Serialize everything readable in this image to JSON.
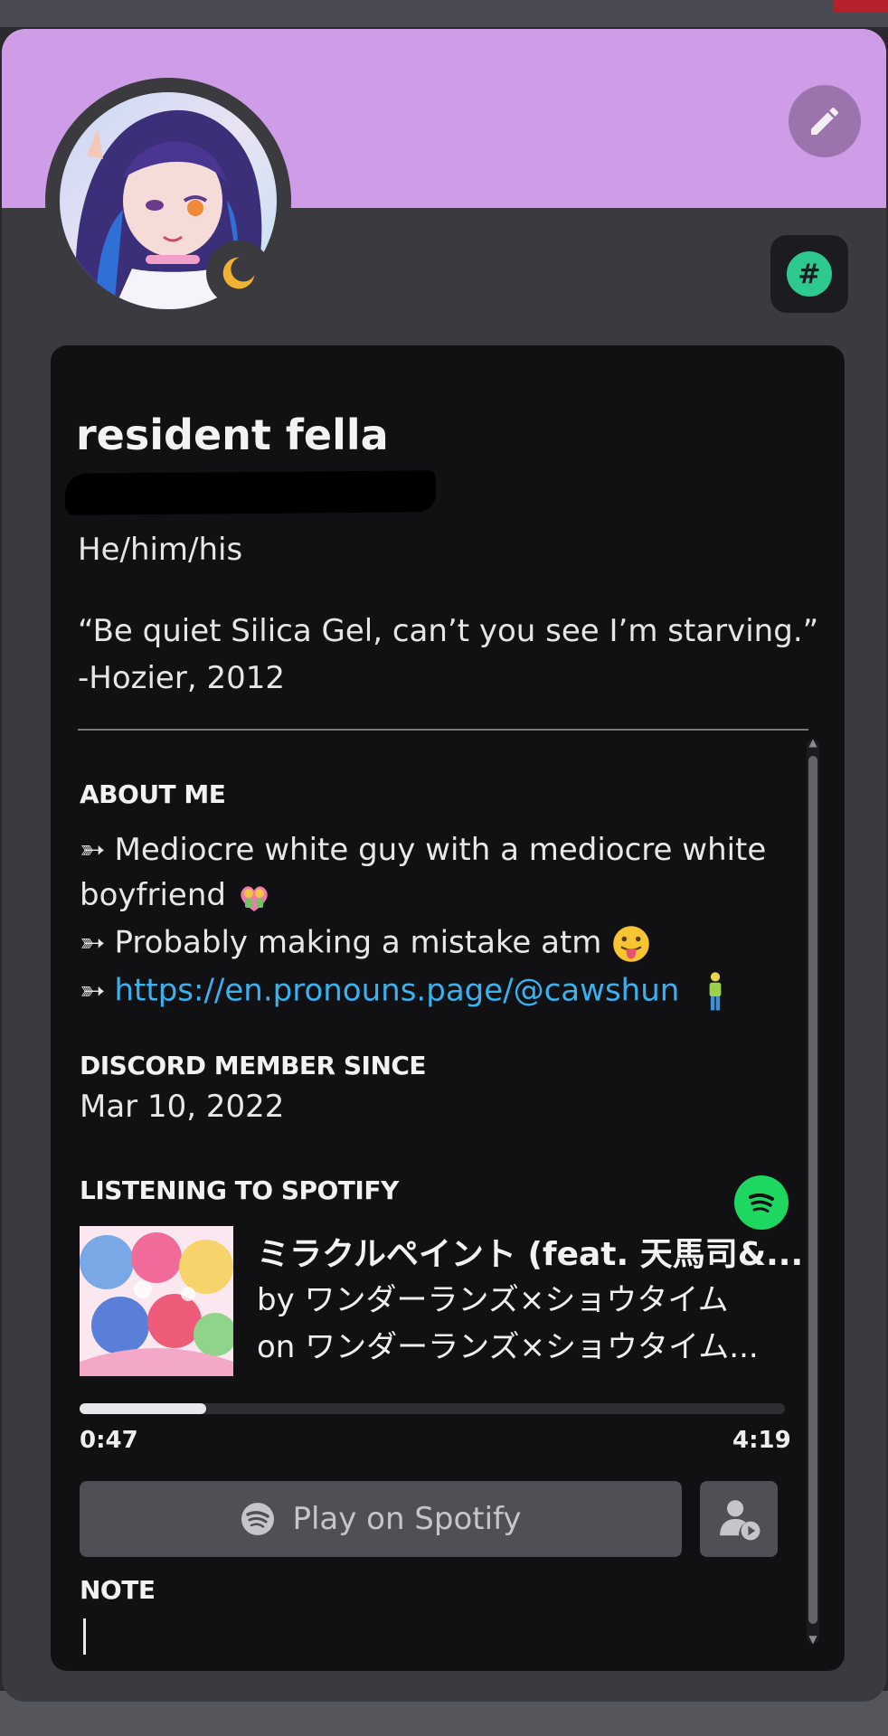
{
  "profile": {
    "display_name": "resident fella",
    "pronouns": "He/him/his",
    "quote_line1": "“Be quiet Silica Gel, can’t you see I’m starving.”",
    "quote_line2": "-Hozier, 2012",
    "status": "idle"
  },
  "about_me": {
    "heading": "ABOUT ME",
    "arrow": "➳",
    "line1": "Mediocre white guy with a mediocre white",
    "line2": "boyfriend",
    "line3": "Probably making a mistake atm",
    "link": "https://en.pronouns.page/@cawshun"
  },
  "member_since": {
    "heading": "DISCORD MEMBER SINCE",
    "date": "Mar 10, 2022"
  },
  "spotify": {
    "heading": "LISTENING TO SPOTIFY",
    "title": "ミラクルペイント (feat. 天馬司&...",
    "artist": "by ワンダーランズ×ショウタイム",
    "album": "on ワンダーランズ×ショウタイム...",
    "elapsed": "0:47",
    "duration": "4:19",
    "progress": 0.18,
    "play_label": "Play on Spotify",
    "brand_color": "#1ed760"
  },
  "note": {
    "heading": "NOTE",
    "value": ""
  },
  "icons": {
    "edit": "pencil-icon",
    "status": "moon-idle-icon",
    "badge": "hash-badge-icon",
    "spotify": "spotify-icon",
    "listen_along": "listen-along-icon"
  },
  "colors": {
    "banner": "#cf9de8",
    "link": "#38b2f0",
    "badge": "#2dc98f",
    "idle": "#f0b232"
  }
}
